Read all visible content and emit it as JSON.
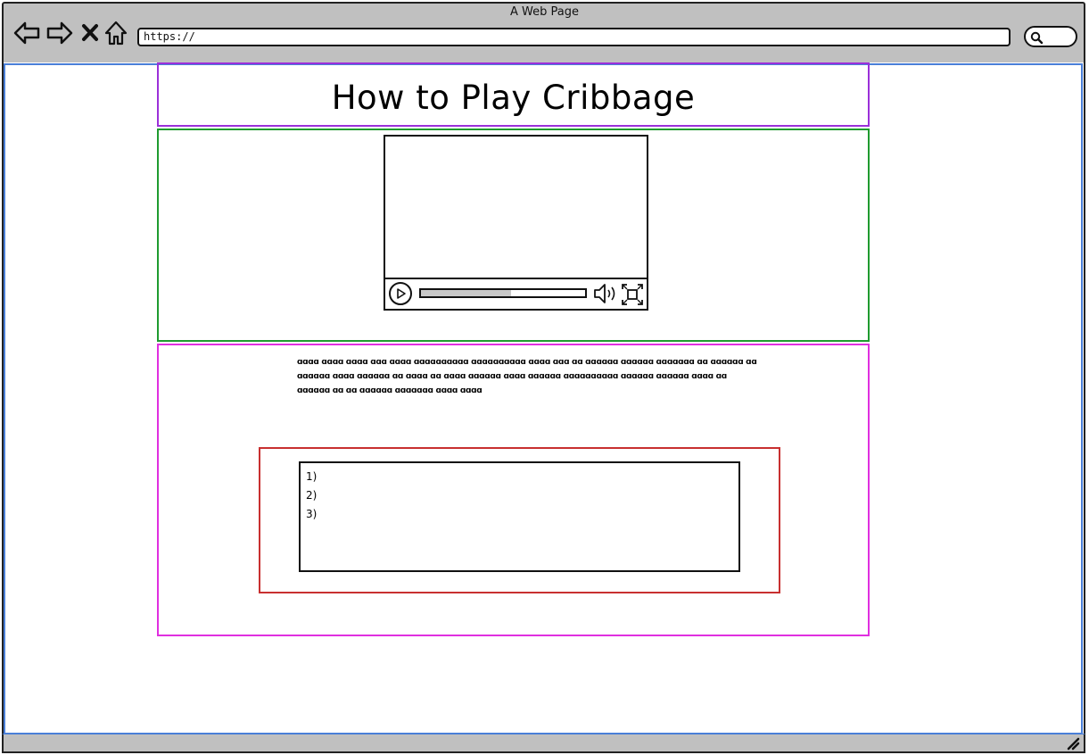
{
  "window": {
    "title": "A Web Page"
  },
  "toolbar": {
    "icons": [
      "back-arrow-icon",
      "forward-arrow-icon",
      "close-icon",
      "home-icon",
      "search-icon",
      "resize-grip-icon"
    ],
    "url": "https://"
  },
  "page": {
    "title": "How to Play Cribbage",
    "video": {
      "progress": 0.55,
      "icons": [
        "play-icon",
        "volume-icon",
        "fullscreen-icon"
      ]
    },
    "paragraph": "ɑɑɑɑ ɑɑɑɑ ɑɑɑɑ ɑɑɑ ɑɑɑɑ ɑɑɑɑɑɑɑɑɑɑ ɑɑɑɑɑɑɑɑɑɑ ɑɑɑɑ ɑɑɑ ɑɑ ɑɑɑɑɑɑ ɑɑɑɑɑɑ ɑɑɑɑɑɑɑ ɑɑ ɑɑɑɑɑɑ ɑɑ ɑɑɑɑɑɑ ɑɑɑɑ ɑɑɑɑɑɑ ɑɑ ɑɑɑɑ ɑɑ ɑɑɑɑ ɑɑɑɑɑɑ ɑɑɑɑ ɑɑɑɑɑɑ ɑɑɑɑɑɑɑɑɑɑ ɑɑɑɑɑɑ ɑɑɑɑɑɑ ɑɑɑɑ ɑɑ ɑɑɑɑɑɑ ɑɑ ɑɑ ɑɑɑɑɑɑ ɑɑɑɑɑɑɑ ɑɑɑɑ ɑɑɑɑ",
    "list": [
      "1)",
      "2)",
      "3)"
    ]
  },
  "colors": {
    "header_region": "#9b30d9",
    "video_region": "#1f9b2f",
    "content_region": "#e02fe0",
    "list_region": "#c83030",
    "viewport_outline": "#4a7fd8",
    "chrome": "#c0c0c0"
  }
}
